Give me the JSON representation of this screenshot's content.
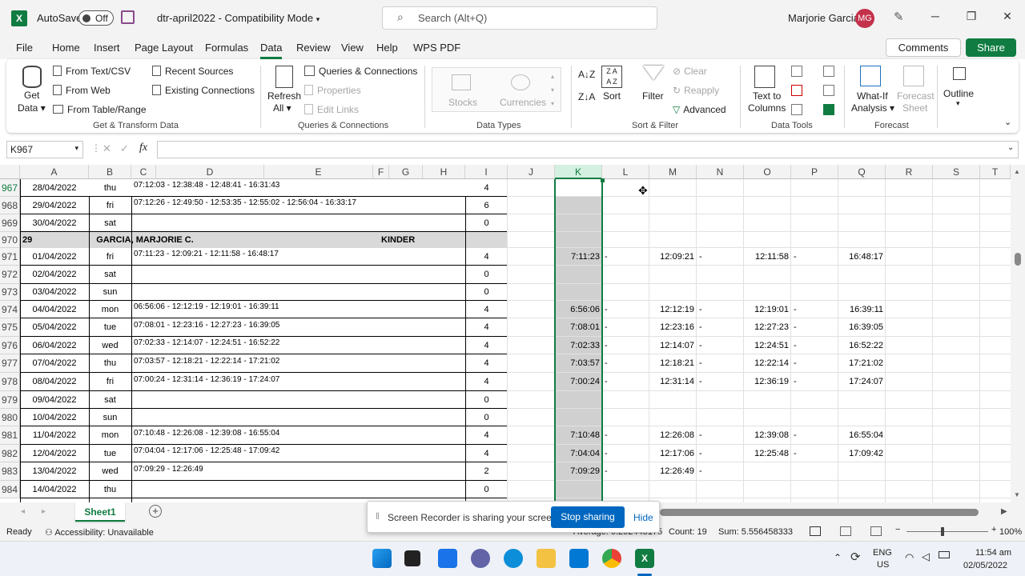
{
  "titlebar": {
    "autosave_label": "AutoSave",
    "autosave_state": "Off",
    "doc_title": "dtr-april2022  -  Compatibility Mode",
    "search_placeholder": "Search (Alt+Q)",
    "user_name": "Marjorie Garcia",
    "user_initials": "MG"
  },
  "menu": {
    "tabs": [
      "File",
      "Home",
      "Insert",
      "Page Layout",
      "Formulas",
      "Data",
      "Review",
      "View",
      "Help",
      "WPS PDF"
    ],
    "active": "Data",
    "comments": "Comments",
    "share": "Share"
  },
  "ribbon": {
    "get_data": "Get",
    "get_data2": "Data",
    "from_text": "From Text/CSV",
    "from_web": "From Web",
    "from_table": "From Table/Range",
    "recent_sources": "Recent Sources",
    "existing_connections": "Existing Connections",
    "group_get": "Get & Transform Data",
    "refresh": "Refresh",
    "refresh2": "All",
    "queries_connections": "Queries & Connections",
    "properties": "Properties",
    "edit_links": "Edit Links",
    "group_queries": "Queries & Connections",
    "stocks": "Stocks",
    "currencies": "Currencies",
    "group_types": "Data Types",
    "sort": "Sort",
    "filter": "Filter",
    "clear": "Clear",
    "reapply": "Reapply",
    "advanced": "Advanced",
    "group_sort": "Sort & Filter",
    "text_to_columns": "Text to",
    "text_to_columns2": "Columns",
    "group_tools": "Data Tools",
    "whatif": "What-If",
    "whatif2": "Analysis",
    "forecast_sheet": "Forecast",
    "forecast_sheet2": "Sheet",
    "group_forecast": "Forecast",
    "outline": "Outline"
  },
  "formula": {
    "name_box": "K967",
    "fx": "fx"
  },
  "columns": [
    "A",
    "B",
    "C",
    "D",
    "E",
    "F",
    "G",
    "H",
    "I",
    "J",
    "K",
    "L",
    "M",
    "N",
    "O",
    "P",
    "Q",
    "R",
    "S",
    "T"
  ],
  "selected_column": "K",
  "rows": [
    {
      "num": "967",
      "a": "28/04/2022",
      "b": "thu",
      "c": "07:12:03 - 12:38:48 - 12:48:41 - 16:31:43",
      "i": "4",
      "k": "",
      "m": "",
      "o": "",
      "q": ""
    },
    {
      "num": "968",
      "a": "29/04/2022",
      "b": "fri",
      "c": "07:12:26 - 12:49:50 - 12:53:35 - 12:55:02 - 12:56:04 - 16:33:17",
      "i": "6",
      "k": "",
      "m": "",
      "o": "",
      "q": ""
    },
    {
      "num": "969",
      "a": "30/04/2022",
      "b": "sat",
      "c": "",
      "i": "0",
      "k": "",
      "m": "",
      "o": "",
      "q": ""
    },
    {
      "num": "970",
      "a": "29",
      "b": "GARCIA, MARJORIE C.",
      "c": "",
      "i": "",
      "e": "KINDER",
      "k": "",
      "m": "",
      "o": "",
      "q": ""
    },
    {
      "num": "971",
      "a": "01/04/2022",
      "b": "fri",
      "c": "07:11:23 - 12:09:21 - 12:11:58 - 16:48:17",
      "i": "4",
      "k": "7:11:23",
      "m": "12:09:21",
      "o": "12:11:58",
      "q": "16:48:17"
    },
    {
      "num": "972",
      "a": "02/04/2022",
      "b": "sat",
      "c": "",
      "i": "0",
      "k": "",
      "m": "",
      "o": "",
      "q": ""
    },
    {
      "num": "973",
      "a": "03/04/2022",
      "b": "sun",
      "c": "",
      "i": "0",
      "k": "",
      "m": "",
      "o": "",
      "q": ""
    },
    {
      "num": "974",
      "a": "04/04/2022",
      "b": "mon",
      "c": "06:56:06 - 12:12:19 - 12:19:01 - 16:39:11",
      "i": "4",
      "k": "6:56:06",
      "m": "12:12:19",
      "o": "12:19:01",
      "q": "16:39:11"
    },
    {
      "num": "975",
      "a": "05/04/2022",
      "b": "tue",
      "c": "07:08:01 - 12:23:16 - 12:27:23 - 16:39:05",
      "i": "4",
      "k": "7:08:01",
      "m": "12:23:16",
      "o": "12:27:23",
      "q": "16:39:05"
    },
    {
      "num": "976",
      "a": "06/04/2022",
      "b": "wed",
      "c": "07:02:33 - 12:14:07 - 12:24:51 - 16:52:22",
      "i": "4",
      "k": "7:02:33",
      "m": "12:14:07",
      "o": "12:24:51",
      "q": "16:52:22"
    },
    {
      "num": "977",
      "a": "07/04/2022",
      "b": "thu",
      "c": "07:03:57 - 12:18:21 - 12:22:14 - 17:21:02",
      "i": "4",
      "k": "7:03:57",
      "m": "12:18:21",
      "o": "12:22:14",
      "q": "17:21:02"
    },
    {
      "num": "978",
      "a": "08/04/2022",
      "b": "fri",
      "c": "07:00:24 - 12:31:14 - 12:36:19 - 17:24:07",
      "i": "4",
      "k": "7:00:24",
      "m": "12:31:14",
      "o": "12:36:19",
      "q": "17:24:07"
    },
    {
      "num": "979",
      "a": "09/04/2022",
      "b": "sat",
      "c": "",
      "i": "0",
      "k": "",
      "m": "",
      "o": "",
      "q": ""
    },
    {
      "num": "980",
      "a": "10/04/2022",
      "b": "sun",
      "c": "",
      "i": "0",
      "k": "",
      "m": "",
      "o": "",
      "q": ""
    },
    {
      "num": "981",
      "a": "11/04/2022",
      "b": "mon",
      "c": "07:10:48 - 12:26:08 - 12:39:08 - 16:55:04",
      "i": "4",
      "k": "7:10:48",
      "m": "12:26:08",
      "o": "12:39:08",
      "q": "16:55:04"
    },
    {
      "num": "982",
      "a": "12/04/2022",
      "b": "tue",
      "c": "07:04:04 - 12:17:06 - 12:25:48 - 17:09:42",
      "i": "4",
      "k": "7:04:04",
      "m": "12:17:06",
      "o": "12:25:48",
      "q": "17:09:42"
    },
    {
      "num": "983",
      "a": "13/04/2022",
      "b": "wed",
      "c": "07:09:29 - 12:26:49",
      "i": "2",
      "k": "7:09:29",
      "m": "12:26:49",
      "o": "",
      "q": ""
    },
    {
      "num": "984",
      "a": "14/04/2022",
      "b": "thu",
      "c": "",
      "i": "0",
      "k": "",
      "m": "",
      "o": "",
      "q": ""
    }
  ],
  "dash": "-",
  "sheet": {
    "tab": "Sheet1"
  },
  "status": {
    "ready": "Ready",
    "accessibility": "Accessibility: Unavailable",
    "average": "Average: 0.292445175",
    "count": "Count: 19",
    "sum": "Sum: 5.556458333",
    "zoom": "100%"
  },
  "toast": {
    "message": "Screen Recorder is sharing your screen.",
    "stop": "Stop sharing",
    "hide": "Hide"
  },
  "taskbar": {
    "lang1": "ENG",
    "lang2": "US",
    "time": "11:54 am",
    "date": "02/05/2022"
  },
  "colors": {
    "accent": "#107c41",
    "selection_fill": "#d0d0d0",
    "band_fill": "#d9d9d9"
  }
}
